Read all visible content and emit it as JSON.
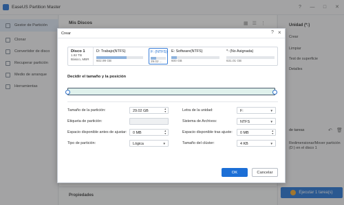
{
  "app": {
    "title": "EaseUS Partition Master"
  },
  "window_controls": {
    "help": "?",
    "minimize": "—",
    "maximize": "□",
    "close": "✕"
  },
  "sidebar": {
    "items": [
      {
        "label": "Gestor de Partición",
        "icon": "disk-icon",
        "active": true
      },
      {
        "label": "Clonar",
        "icon": "clone-icon"
      },
      {
        "label": "Convertidor de disco",
        "icon": "convert-icon"
      },
      {
        "label": "Recuperar partición",
        "icon": "recover-icon"
      },
      {
        "label": "Medio de arranque",
        "icon": "boot-media-icon"
      },
      {
        "label": "Herramientas",
        "icon": "tools-icon"
      }
    ]
  },
  "main": {
    "title": "Mis Discos",
    "properties_label": "Propiedades"
  },
  "right_panel": {
    "unit_label": "Unidad (*:)",
    "actions": [
      "Crear",
      "Limpiar",
      "Test de superficie",
      "Detalles"
    ],
    "tasks_label": "de tareas",
    "task_description": "Redimensionar/Mover partición (D:) en el disco 1",
    "execute_label": "Ejecutar 1 tarea(s)"
  },
  "dialog": {
    "title": "Crear",
    "disk": {
      "name": "Disco 1",
      "size": "1.82 TB",
      "type": "Básico, MBR"
    },
    "partitions": [
      {
        "name": "D: Trabajo(NTFS)",
        "size": "602.99 GB",
        "fill": 0.65,
        "selected": false
      },
      {
        "name": "F: (NTFS)",
        "size": "29.02 ...",
        "fill": 0.35,
        "selected": true
      },
      {
        "name": "E: Software(NTFS)",
        "size": "600 GB",
        "fill": 0.12,
        "selected": false
      },
      {
        "name": "*: (No Asignada)",
        "size": "631.01 GB",
        "fill": 0.0,
        "selected": false
      }
    ],
    "section_title": "Decidir el tamaño y la posición",
    "form": {
      "partition_size_label": "Tamaño de la partición:",
      "partition_size_value": "29.02 GB",
      "partition_label_label": "Etiqueta de partición:",
      "partition_label_value": "",
      "space_before_label": "Espacio disponible antes de ajustar:",
      "space_before_value": "0 MB",
      "partition_type_label": "Tipo de partición:",
      "partition_type_value": "Lógica",
      "drive_letter_label": "Letra de la unidad:",
      "drive_letter_value": "F:",
      "file_system_label": "Sistema de Archivos:",
      "file_system_value": "NTFS",
      "space_after_label": "Espacio disponible tras ajuste:",
      "space_after_value": "0 MB",
      "cluster_size_label": "Tamaño del clúster:",
      "cluster_size_value": "4 KB"
    },
    "ok_label": "OK",
    "cancel_label": "Cancelar"
  }
}
